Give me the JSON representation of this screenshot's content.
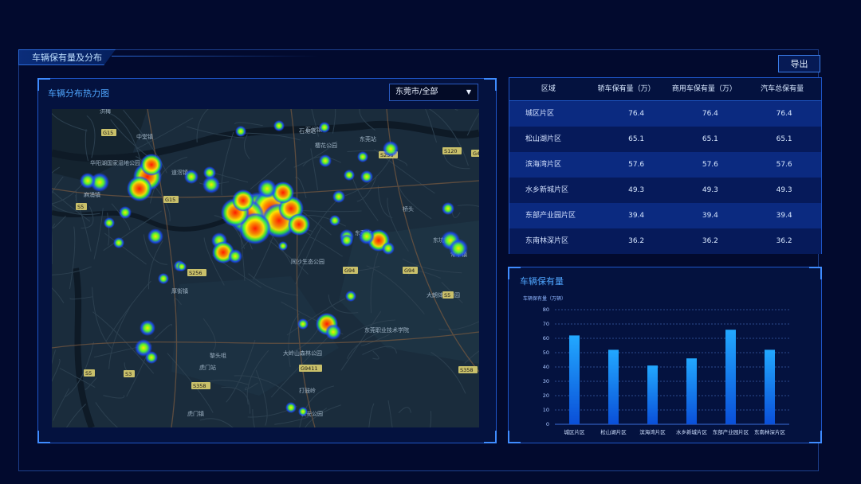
{
  "header": {
    "title": "车辆保有量及分布",
    "export_label": "导出"
  },
  "map_panel": {
    "title": "车辆分布热力图",
    "selected_city": "东莞市/全部",
    "labels": [
      "石龙镇",
      "石龙站",
      "东莞站",
      "樱花公园",
      "中堂镇",
      "华阳湖国家湿地公园",
      "东莞市",
      "东坑镇",
      "常平镇",
      "同沙生态公园",
      "大朗体育公园",
      "厚街镇",
      "东莞职业技术学院",
      "大岭山森林公园",
      "黎头咀",
      "虎门站",
      "打鼓岭",
      "长安公园",
      "虎门镇",
      "道滘镇",
      "麻涌镇",
      "桥头",
      "洪梅"
    ],
    "road_labels": [
      "G15",
      "G15",
      "S120",
      "G4",
      "S256",
      "G94",
      "S358",
      "S5",
      "S3",
      "S5",
      "G9411",
      "S358",
      "G94",
      "S5",
      "S256"
    ]
  },
  "table": {
    "headers": [
      "区域",
      "轿车保有量（万）",
      "商用车保有量（万）",
      "汽车总保有量"
    ],
    "rows": [
      [
        "城区片区",
        "76.4",
        "76.4",
        "76.4"
      ],
      [
        "松山湖片区",
        "65.1",
        "65.1",
        "65.1"
      ],
      [
        "滨海湾片区",
        "57.6",
        "57.6",
        "57.6"
      ],
      [
        "水乡新城片区",
        "49.3",
        "49.3",
        "49.3"
      ],
      [
        "东部产业园片区",
        "39.4",
        "39.4",
        "39.4"
      ],
      [
        "东南林深片区",
        "36.2",
        "36.2",
        "36.2"
      ]
    ]
  },
  "chart_panel": {
    "title": "车辆保有量"
  },
  "chart_data": {
    "type": "bar",
    "ylabel": "车辆保有量（万辆）",
    "categories": [
      "城区片区",
      "松山湖片区",
      "滨海湾片区",
      "水乡新城片区",
      "东部产业园片区",
      "东南林深片区"
    ],
    "values": [
      62,
      52,
      41,
      46,
      66,
      52
    ],
    "ylim": [
      0,
      80
    ],
    "yticks": [
      0,
      10,
      20,
      30,
      40,
      50,
      60,
      70,
      80
    ],
    "grid": true,
    "bar_color_top": "#22a8ff",
    "bar_color_bottom": "#0a4fd8"
  }
}
